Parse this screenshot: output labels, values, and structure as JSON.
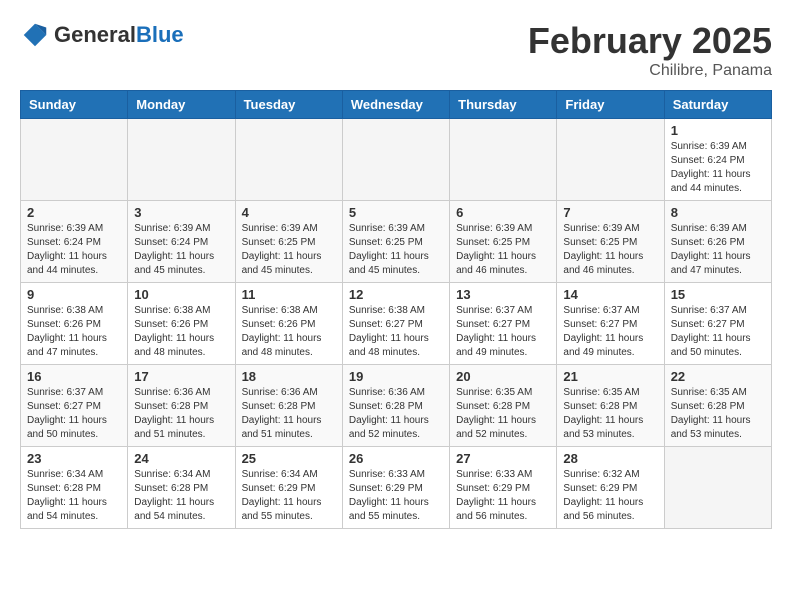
{
  "header": {
    "logo_general": "General",
    "logo_blue": "Blue",
    "month_title": "February 2025",
    "subtitle": "Chilibre, Panama"
  },
  "days_of_week": [
    "Sunday",
    "Monday",
    "Tuesday",
    "Wednesday",
    "Thursday",
    "Friday",
    "Saturday"
  ],
  "weeks": [
    [
      {
        "day": "",
        "info": ""
      },
      {
        "day": "",
        "info": ""
      },
      {
        "day": "",
        "info": ""
      },
      {
        "day": "",
        "info": ""
      },
      {
        "day": "",
        "info": ""
      },
      {
        "day": "",
        "info": ""
      },
      {
        "day": "1",
        "info": "Sunrise: 6:39 AM\nSunset: 6:24 PM\nDaylight: 11 hours and 44 minutes."
      }
    ],
    [
      {
        "day": "2",
        "info": "Sunrise: 6:39 AM\nSunset: 6:24 PM\nDaylight: 11 hours and 44 minutes."
      },
      {
        "day": "3",
        "info": "Sunrise: 6:39 AM\nSunset: 6:24 PM\nDaylight: 11 hours and 45 minutes."
      },
      {
        "day": "4",
        "info": "Sunrise: 6:39 AM\nSunset: 6:25 PM\nDaylight: 11 hours and 45 minutes."
      },
      {
        "day": "5",
        "info": "Sunrise: 6:39 AM\nSunset: 6:25 PM\nDaylight: 11 hours and 45 minutes."
      },
      {
        "day": "6",
        "info": "Sunrise: 6:39 AM\nSunset: 6:25 PM\nDaylight: 11 hours and 46 minutes."
      },
      {
        "day": "7",
        "info": "Sunrise: 6:39 AM\nSunset: 6:25 PM\nDaylight: 11 hours and 46 minutes."
      },
      {
        "day": "8",
        "info": "Sunrise: 6:39 AM\nSunset: 6:26 PM\nDaylight: 11 hours and 47 minutes."
      }
    ],
    [
      {
        "day": "9",
        "info": "Sunrise: 6:38 AM\nSunset: 6:26 PM\nDaylight: 11 hours and 47 minutes."
      },
      {
        "day": "10",
        "info": "Sunrise: 6:38 AM\nSunset: 6:26 PM\nDaylight: 11 hours and 48 minutes."
      },
      {
        "day": "11",
        "info": "Sunrise: 6:38 AM\nSunset: 6:26 PM\nDaylight: 11 hours and 48 minutes."
      },
      {
        "day": "12",
        "info": "Sunrise: 6:38 AM\nSunset: 6:27 PM\nDaylight: 11 hours and 48 minutes."
      },
      {
        "day": "13",
        "info": "Sunrise: 6:37 AM\nSunset: 6:27 PM\nDaylight: 11 hours and 49 minutes."
      },
      {
        "day": "14",
        "info": "Sunrise: 6:37 AM\nSunset: 6:27 PM\nDaylight: 11 hours and 49 minutes."
      },
      {
        "day": "15",
        "info": "Sunrise: 6:37 AM\nSunset: 6:27 PM\nDaylight: 11 hours and 50 minutes."
      }
    ],
    [
      {
        "day": "16",
        "info": "Sunrise: 6:37 AM\nSunset: 6:27 PM\nDaylight: 11 hours and 50 minutes."
      },
      {
        "day": "17",
        "info": "Sunrise: 6:36 AM\nSunset: 6:28 PM\nDaylight: 11 hours and 51 minutes."
      },
      {
        "day": "18",
        "info": "Sunrise: 6:36 AM\nSunset: 6:28 PM\nDaylight: 11 hours and 51 minutes."
      },
      {
        "day": "19",
        "info": "Sunrise: 6:36 AM\nSunset: 6:28 PM\nDaylight: 11 hours and 52 minutes."
      },
      {
        "day": "20",
        "info": "Sunrise: 6:35 AM\nSunset: 6:28 PM\nDaylight: 11 hours and 52 minutes."
      },
      {
        "day": "21",
        "info": "Sunrise: 6:35 AM\nSunset: 6:28 PM\nDaylight: 11 hours and 53 minutes."
      },
      {
        "day": "22",
        "info": "Sunrise: 6:35 AM\nSunset: 6:28 PM\nDaylight: 11 hours and 53 minutes."
      }
    ],
    [
      {
        "day": "23",
        "info": "Sunrise: 6:34 AM\nSunset: 6:28 PM\nDaylight: 11 hours and 54 minutes."
      },
      {
        "day": "24",
        "info": "Sunrise: 6:34 AM\nSunset: 6:28 PM\nDaylight: 11 hours and 54 minutes."
      },
      {
        "day": "25",
        "info": "Sunrise: 6:34 AM\nSunset: 6:29 PM\nDaylight: 11 hours and 55 minutes."
      },
      {
        "day": "26",
        "info": "Sunrise: 6:33 AM\nSunset: 6:29 PM\nDaylight: 11 hours and 55 minutes."
      },
      {
        "day": "27",
        "info": "Sunrise: 6:33 AM\nSunset: 6:29 PM\nDaylight: 11 hours and 56 minutes."
      },
      {
        "day": "28",
        "info": "Sunrise: 6:32 AM\nSunset: 6:29 PM\nDaylight: 11 hours and 56 minutes."
      },
      {
        "day": "",
        "info": ""
      }
    ]
  ]
}
